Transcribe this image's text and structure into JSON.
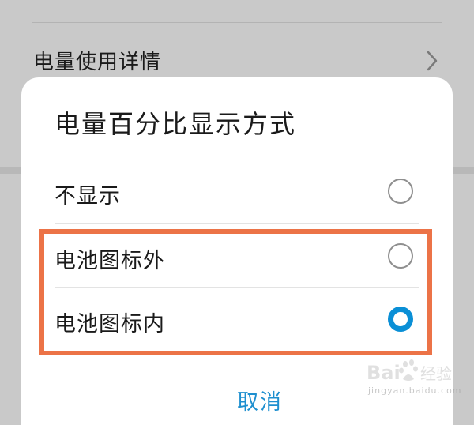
{
  "background": {
    "row_label": "电量使用详情",
    "chevron_icon": "chevron-right-icon"
  },
  "dialog": {
    "title": "电量百分比显示方式",
    "options": [
      {
        "label": "不显示",
        "selected": false
      },
      {
        "label": "电池图标外",
        "selected": false
      },
      {
        "label": "电池图标内",
        "selected": true
      }
    ],
    "cancel_label": "取消"
  },
  "annotation": {
    "highlight_color": "#ec7347"
  },
  "colors": {
    "accent": "#0a8fd6",
    "cancel_text": "#1e8fcf"
  },
  "watermark": {
    "logo_text": "Bai 经验",
    "sub_text": "jingyan.baidu.com"
  }
}
